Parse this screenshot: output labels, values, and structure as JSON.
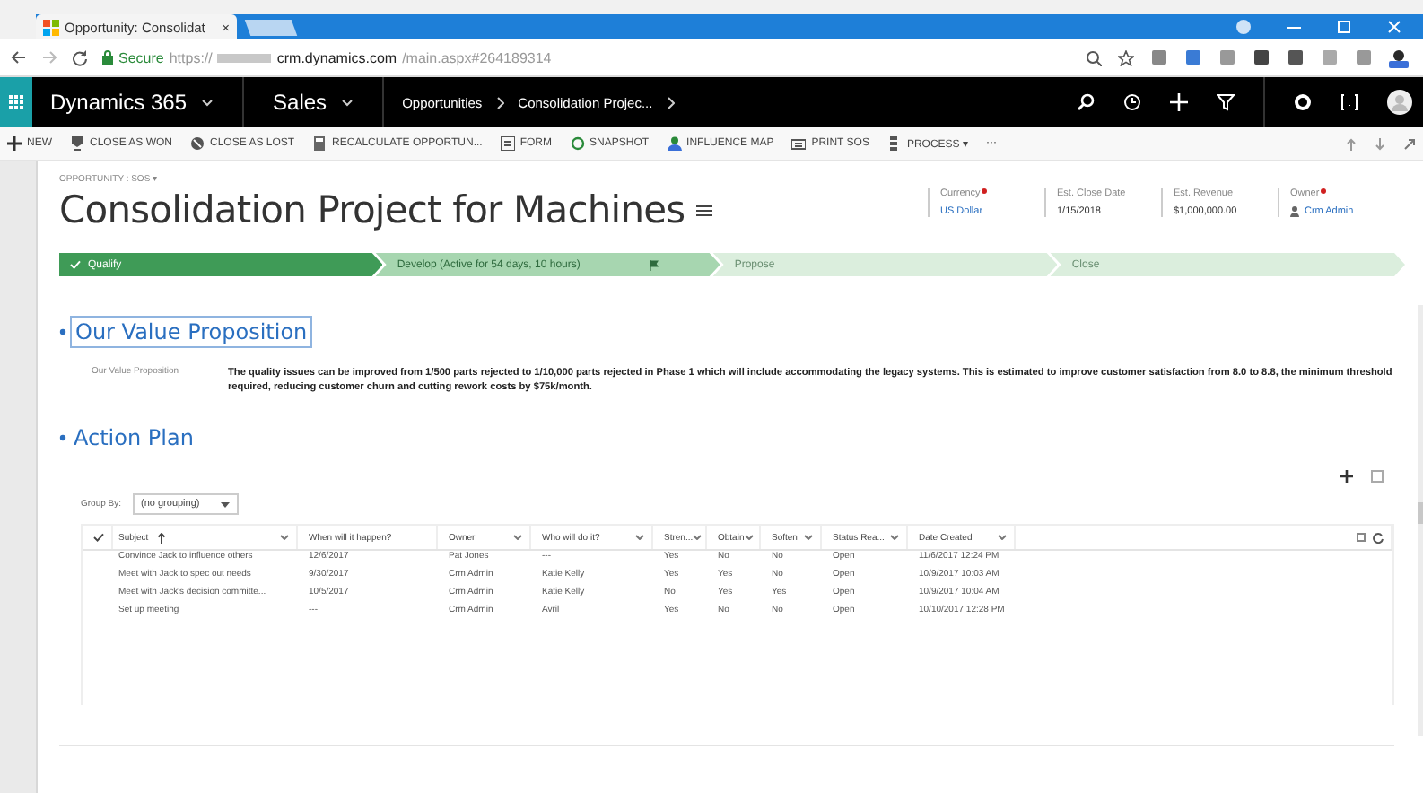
{
  "browser": {
    "tab": {
      "title": "Opportunity: Consolidat",
      "close": "×"
    },
    "secure_label": "Secure",
    "url_scheme": "https://",
    "url_host": "crm.dynamics.com",
    "url_path": "/main.aspx#264189314"
  },
  "nav": {
    "app": "Dynamics 365",
    "area": "Sales",
    "breadcrumbs": [
      {
        "label": "Opportunities"
      },
      {
        "label": "Consolidation Projec..."
      }
    ]
  },
  "commands": [
    {
      "label": "NEW"
    },
    {
      "label": "CLOSE AS WON"
    },
    {
      "label": "CLOSE AS LOST"
    },
    {
      "label": "RECALCULATE OPPORTUN..."
    },
    {
      "label": "FORM"
    },
    {
      "label": "SNAPSHOT"
    },
    {
      "label": "INFLUENCE MAP"
    },
    {
      "label": "PRINT SOS"
    },
    {
      "label": "PROCESS ▾"
    },
    {
      "label": "···"
    }
  ],
  "form_selector": "OPPORTUNITY : SOS ▾",
  "record_title": "Consolidation Project for Machines",
  "header_fields": [
    {
      "label": "Currency",
      "required": true,
      "value": "US Dollar",
      "kind": "link"
    },
    {
      "label": "Est. Close Date",
      "required": false,
      "value": "1/15/2018",
      "kind": "text"
    },
    {
      "label": "Est. Revenue",
      "required": false,
      "value": "$1,000,000.00",
      "kind": "text"
    },
    {
      "label": "Owner",
      "required": true,
      "value": "Crm Admin",
      "kind": "user"
    }
  ],
  "stages": [
    {
      "label": "Qualify",
      "completed": true,
      "selected": false
    },
    {
      "label": "Develop (Active for 54 days, 10 hours)",
      "completed": false,
      "selected": true
    },
    {
      "label": "Propose",
      "completed": false,
      "selected": false
    },
    {
      "label": "Close",
      "completed": false,
      "selected": false
    }
  ],
  "value_section": {
    "title": "Our Value Proposition",
    "field_label": "Our Value Proposition",
    "text": "The quality issues can be improved from 1/500 parts rejected to 1/10,000 parts rejected in Phase 1 which will include accommodating the legacy systems. This is estimated to improve customer satisfaction from 8.0 to 8.8, the minimum threshold required, reducing customer churn and cutting rework costs by $75k/month."
  },
  "action_plan": {
    "title": "Action Plan",
    "group_by_label": "Group By:",
    "group_by_value": "(no grouping)",
    "columns": [
      "Subject",
      "When will it happen?",
      "Owner",
      "Who will do it?",
      "Stren...",
      "Obtain",
      "Soften",
      "Status Rea...",
      "Date Created"
    ],
    "rows": [
      [
        "Convince Jack to influence others",
        "12/6/2017",
        "Pat Jones",
        "---",
        "Yes",
        "No",
        "No",
        "Open",
        "11/6/2017 12:24 PM"
      ],
      [
        "Meet with Jack to spec out needs",
        "9/30/2017",
        "Crm Admin",
        "Katie Kelly",
        "Yes",
        "Yes",
        "No",
        "Open",
        "10/9/2017 10:03 AM"
      ],
      [
        "Meet with Jack's decision committe...",
        "10/5/2017",
        "Crm Admin",
        "Katie Kelly",
        "No",
        "Yes",
        "Yes",
        "Open",
        "10/9/2017 10:04 AM"
      ],
      [
        "Set up meeting",
        "---",
        "Crm Admin",
        "Avril",
        "Yes",
        "No",
        "No",
        "Open",
        "10/10/2017 12:28 PM"
      ]
    ]
  }
}
